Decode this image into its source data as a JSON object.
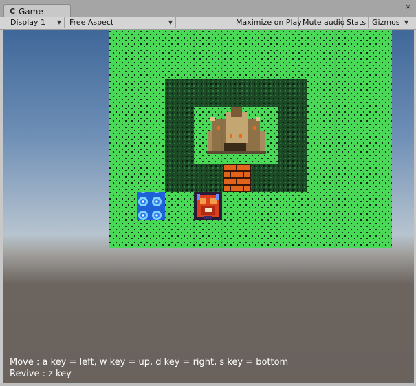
{
  "window": {
    "tab_title": "Game",
    "tab_icon": "unity-game-view-icon",
    "menu_icon": "kebab-menu-icon",
    "close_icon": "close-icon"
  },
  "toolbar": {
    "display": "Display 1",
    "aspect": "Free Aspect",
    "maximize_on_play": "Maximize on Play",
    "mute_audio": "Mute audio",
    "stats": "Stats",
    "gizmos": "Gizmos"
  },
  "game": {
    "grass_color": "#49d957",
    "forest_color": "#1c4a26",
    "tiles": {
      "castle": "castle-sprite",
      "bridge": "brick-bridge-sprite",
      "water": "blue-flower-tile-sprite",
      "player": "red-armored-hero-sprite"
    }
  },
  "instructions": {
    "move": "Move : a key = left, w key = up, d key = right, s key = bottom",
    "revive": "Revive : z key"
  }
}
